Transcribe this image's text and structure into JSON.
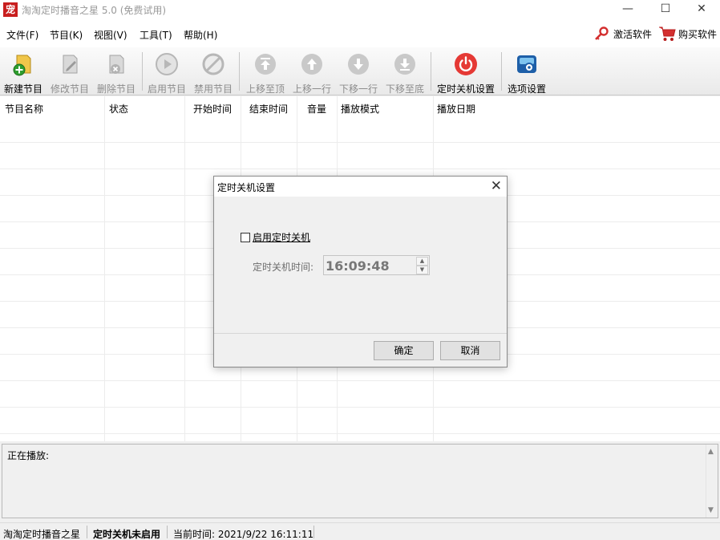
{
  "window": {
    "app_icon_text": "宠",
    "title": "淘淘定时播音之星 5.0 (免费试用)",
    "minimize_glyph": "—",
    "maximize_glyph": "☐",
    "close_glyph": "✕"
  },
  "menu": {
    "items": [
      "文件(F)",
      "节目(K)",
      "视图(V)",
      "工具(T)",
      "帮助(H)"
    ],
    "activate_label": "激活软件",
    "buy_label": "购买软件"
  },
  "toolbar": {
    "buttons": [
      {
        "label": "新建节目",
        "icon": "new-program-icon",
        "enabled": true
      },
      {
        "label": "修改节目",
        "icon": "edit-program-icon",
        "enabled": false
      },
      {
        "label": "删除节目",
        "icon": "delete-program-icon",
        "enabled": false
      },
      {
        "label": "启用节目",
        "icon": "play-icon",
        "enabled": false
      },
      {
        "label": "禁用节目",
        "icon": "ban-icon",
        "enabled": false
      },
      {
        "label": "上移至顶",
        "icon": "move-top-icon",
        "enabled": false
      },
      {
        "label": "上移一行",
        "icon": "move-up-icon",
        "enabled": false
      },
      {
        "label": "下移一行",
        "icon": "move-down-icon",
        "enabled": false
      },
      {
        "label": "下移至底",
        "icon": "move-bottom-icon",
        "enabled": false
      },
      {
        "label": "定时关机设置",
        "icon": "power-icon",
        "enabled": true
      },
      {
        "label": "选项设置",
        "icon": "settings-icon",
        "enabled": true
      }
    ]
  },
  "list": {
    "columns": [
      "节目名称",
      "状态",
      "开始时间",
      "结束时间",
      "音量",
      "播放模式",
      "播放日期"
    ],
    "rows": []
  },
  "playing": {
    "label": "正在播放:"
  },
  "status": {
    "app_name": "淘淘定时播音之星",
    "shutdown_state": "定时关机未启用",
    "current_time": "当前时间: 2021/9/22 16:11:11"
  },
  "dialog": {
    "title": "定时关机设置",
    "enable_label": "启用定时关机",
    "enable_checked": false,
    "time_label": "定时关机时间:",
    "time_value": "16:09:48",
    "ok_label": "确定",
    "cancel_label": "取消"
  },
  "colors": {
    "power_red": "#e53935",
    "new_green": "#2e9d2e"
  }
}
